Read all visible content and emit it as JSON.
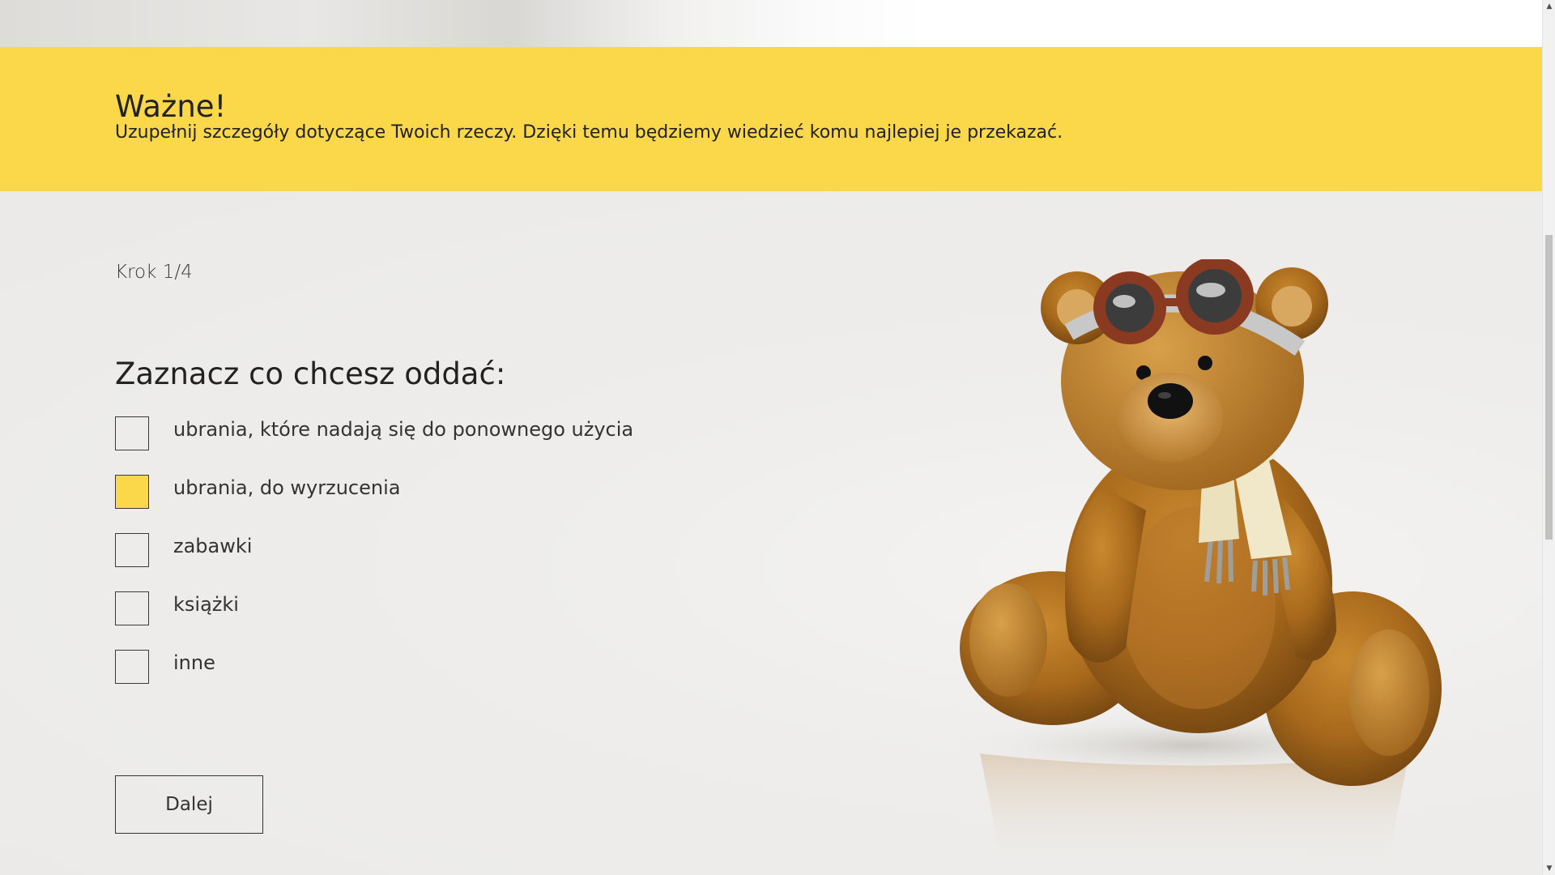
{
  "banner": {
    "title": "Ważne!",
    "text": "Uzupełnij szczegóły dotyczące Twoich rzeczy. Dzięki temu będziemy wiedzieć komu najlepiej je przekazać."
  },
  "form": {
    "step": "Krok 1/4",
    "question": "Zaznacz co chcesz oddać:",
    "options": [
      {
        "label": "ubrania, które nadają się do ponownego użycia",
        "checked": false
      },
      {
        "label": "ubrania, do wyrzucenia",
        "checked": true
      },
      {
        "label": "zabawki",
        "checked": false
      },
      {
        "label": "książki",
        "checked": false
      },
      {
        "label": "inne",
        "checked": false
      }
    ],
    "next_label": "Dalej"
  },
  "colors": {
    "accent": "#fbd74a",
    "background": "#ecebea",
    "text": "#222222"
  },
  "icons": {
    "illustration": "teddy-bear-aviator",
    "scroll_up": "scroll-up-arrow-icon",
    "scroll_down": "scroll-down-arrow-icon"
  }
}
